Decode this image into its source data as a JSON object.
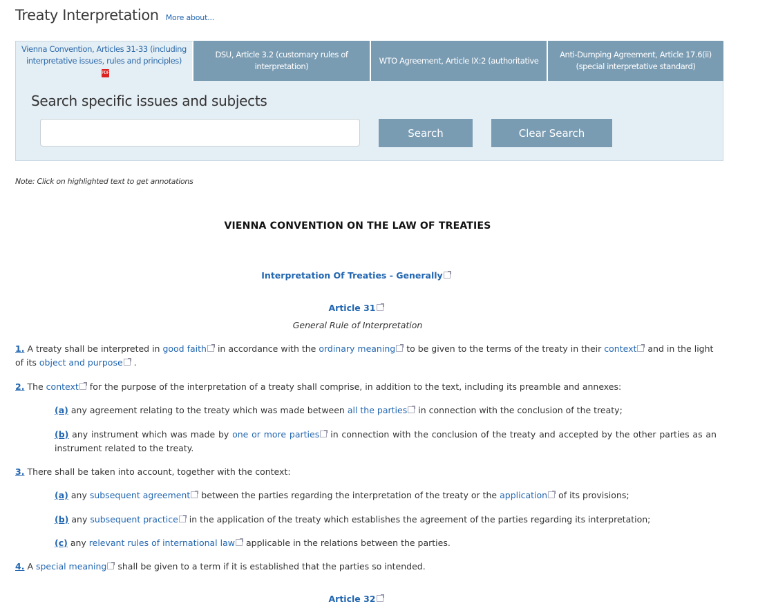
{
  "header": {
    "title": "Treaty Interpretation",
    "more_link": "More about..."
  },
  "tabs": [
    {
      "label": "Vienna Convention, Articles 31-33 (including interpretative issues, rules and principles)",
      "active": true
    },
    {
      "label": "DSU, Article 3.2 (customary rules of interpretation)"
    },
    {
      "label": "WTO Agreement, Article IX:2 (authoritative"
    },
    {
      "label": "Anti-Dumping Agreement, Article 17.6(ii) (special interpretative standard)"
    }
  ],
  "search": {
    "heading": "Search specific issues and subjects",
    "input_value": "",
    "search_label": "Search",
    "clear_label": "Clear Search"
  },
  "note": "Note: Click on highlighted text to get annotations",
  "document": {
    "title": "VIENNA CONVENTION ON THE LAW OF TREATIES",
    "section_heading": "Interpretation Of Treaties - Generally",
    "article31": {
      "heading": "Article 31",
      "subtitle": "General Rule of Interpretation"
    },
    "p1": {
      "num": "1.",
      "t1": "A treaty shall be interpreted in ",
      "l1": "good faith",
      "t2": "in accordance with the ",
      "l2": "ordinary meaning",
      "t3": "to be given to the terms of the treaty in their ",
      "l3": "context",
      "t4": "and in the light of its ",
      "l4": "object and purpose",
      "t5": "."
    },
    "p2": {
      "num": "2.",
      "t1": "The ",
      "l1": "context",
      "t2": "for the purpose of the interpretation of a treaty shall comprise, in addition to the text, including its preamble and annexes:"
    },
    "p2a": {
      "num": "(a)",
      "t1": "any agreement relating to the treaty which was made between ",
      "l1": "all the parties",
      "t2": "in connection with the conclusion of the treaty;"
    },
    "p2b": {
      "num": "(b)",
      "t1": "any instrument which was made by ",
      "l1": "one or more parties",
      "t2": "in connection with the conclusion of the treaty and accepted by the other parties as an instrument related to the treaty."
    },
    "p3": {
      "num": "3.",
      "t1": "There shall be taken into account, together with the context:"
    },
    "p3a": {
      "num": "(a)",
      "t1": "any ",
      "l1": "subsequent agreement",
      "t2": "between the parties regarding the interpretation of the treaty or the ",
      "l2": "application",
      "t3": "of its provisions;"
    },
    "p3b": {
      "num": "(b)",
      "t1": "any ",
      "l1": "subsequent practice",
      "t2": "in the application of the treaty which establishes the agreement of the parties regarding its interpretation;"
    },
    "p3c": {
      "num": "(c)",
      "t1": "any ",
      "l1": "relevant rules of international law",
      "t2": "applicable in the relations between the parties."
    },
    "p4": {
      "num": "4.",
      "t1": "A ",
      "l1": "special meaning",
      "t2": "shall be given to a term if it is established that the parties so intended."
    },
    "article32": {
      "heading": "Article 32"
    }
  }
}
